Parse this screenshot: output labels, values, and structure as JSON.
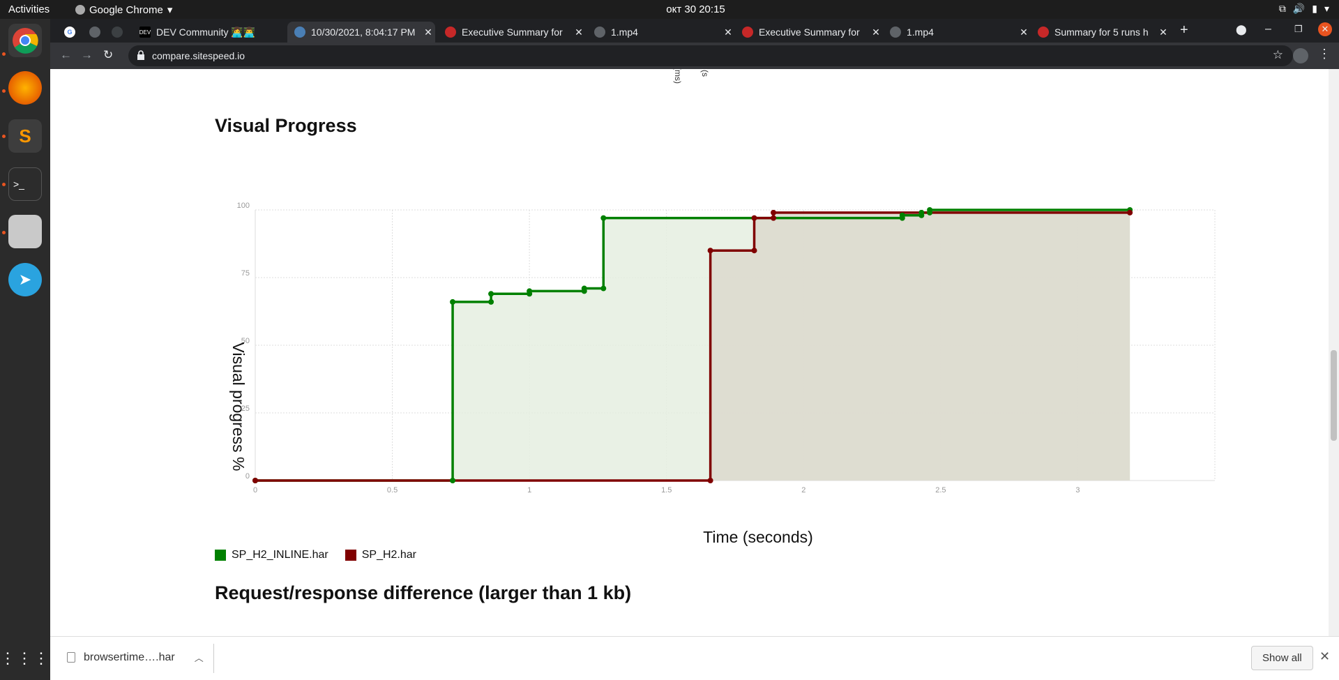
{
  "topbar": {
    "activities": "Activities",
    "app": "Google Chrome",
    "clock": "окт 30  20:15"
  },
  "tabs": [
    {
      "title": "",
      "fav_color": "#3c4043",
      "fav_text": "G"
    },
    {
      "title": "",
      "fav_color": "#3c4043",
      "fav_text": ""
    },
    {
      "title": "",
      "fav_color": "#3c4043",
      "fav_text": ""
    },
    {
      "title": "DEV Community 👩‍💻👨‍💻",
      "fav_color": "#000000",
      "fav_text": "DEV"
    },
    {
      "title": "10/30/2021, 8:04:17 PM",
      "fav_color": "#4a7fb5",
      "fav_text": ""
    },
    {
      "title": "Executive Summary for",
      "fav_color": "#c62828",
      "fav_text": ""
    },
    {
      "title": "1.mp4",
      "fav_color": "#5f6368",
      "fav_text": ""
    },
    {
      "title": "Executive Summary for",
      "fav_color": "#c62828",
      "fav_text": ""
    },
    {
      "title": "1.mp4",
      "fav_color": "#5f6368",
      "fav_text": ""
    },
    {
      "title": "Summary for 5 runs h",
      "fav_color": "#c62828",
      "fav_text": ""
    }
  ],
  "omnibox": {
    "url": "compare.sitespeed.io"
  },
  "page": {
    "section_title": "Visual Progress",
    "next_section_title": "Request/response difference (larger than 1 kb)"
  },
  "chart_data": {
    "type": "line",
    "title": "Visual Progress",
    "xlabel": "Time (seconds)",
    "ylabel": "Visual progress %",
    "xlim": [
      0,
      3.5
    ],
    "ylim": [
      0,
      100
    ],
    "xticks": [
      "0",
      "0.5",
      "1",
      "1.5",
      "2",
      "2.5",
      "3"
    ],
    "yticks": [
      "0",
      "25",
      "50",
      "75",
      "100"
    ],
    "grid": true,
    "legend_position": "bottom-left",
    "step": true,
    "series": [
      {
        "name": "SP_H2_INLINE.har",
        "color": "#008000",
        "fill": "#e5efe1",
        "points": [
          [
            0,
            0
          ],
          [
            0.72,
            0
          ],
          [
            0.72,
            66
          ],
          [
            0.86,
            66
          ],
          [
            0.86,
            69
          ],
          [
            1.0,
            69
          ],
          [
            1.0,
            70
          ],
          [
            1.2,
            70
          ],
          [
            1.2,
            71
          ],
          [
            1.27,
            71
          ],
          [
            1.27,
            97
          ],
          [
            2.36,
            97
          ],
          [
            2.36,
            98
          ],
          [
            2.43,
            98
          ],
          [
            2.43,
            99
          ],
          [
            2.46,
            99
          ],
          [
            2.46,
            100
          ],
          [
            3.19,
            100
          ]
        ]
      },
      {
        "name": "SP_H2.har",
        "color": "#800000",
        "fill": "#dcd9ce",
        "points": [
          [
            0,
            0
          ],
          [
            1.66,
            0
          ],
          [
            1.66,
            85
          ],
          [
            1.82,
            85
          ],
          [
            1.82,
            97
          ],
          [
            1.89,
            97
          ],
          [
            1.89,
            99
          ],
          [
            3.19,
            99
          ]
        ]
      }
    ]
  },
  "downloads": {
    "file": "browsertime….har",
    "show_all": "Show all"
  }
}
